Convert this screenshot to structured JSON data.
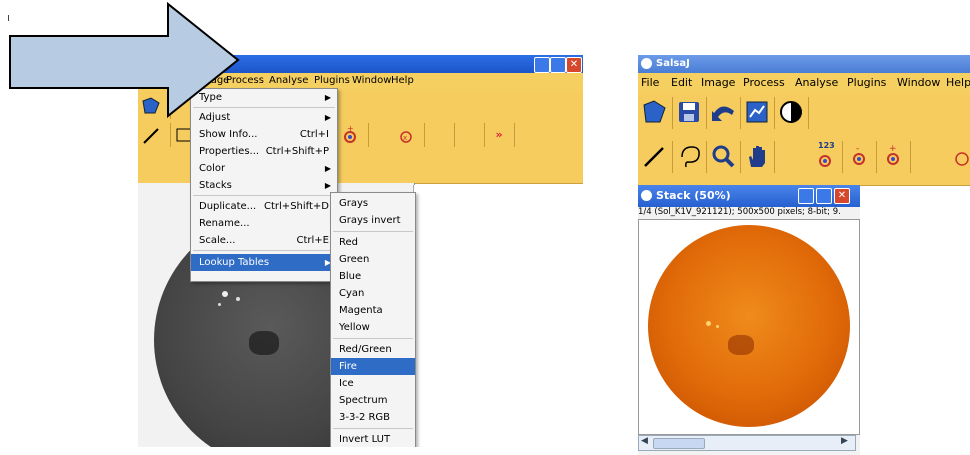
{
  "left": {
    "menubar": [
      "Image",
      "Process",
      "Analyse",
      "Plugins",
      "Window",
      "Help"
    ],
    "image_menu": {
      "items": [
        {
          "label": "Type",
          "shortcut": "",
          "submenu": true
        },
        {
          "label": "Adjust",
          "shortcut": "",
          "submenu": true
        },
        {
          "label": "Show Info...",
          "shortcut": "Ctrl+I",
          "submenu": false
        },
        {
          "label": "Properties...",
          "shortcut": "Ctrl+Shift+P",
          "submenu": false
        },
        {
          "label": "Color",
          "shortcut": "",
          "submenu": true
        },
        {
          "label": "Stacks",
          "shortcut": "",
          "submenu": true
        },
        {
          "label": "Duplicate...",
          "shortcut": "Ctrl+Shift+D",
          "submenu": false
        },
        {
          "label": "Rename...",
          "shortcut": "",
          "submenu": false
        },
        {
          "label": "Scale...",
          "shortcut": "Ctrl+E",
          "submenu": false
        },
        {
          "label": "Lookup Tables",
          "shortcut": "",
          "submenu": true,
          "selected": true
        }
      ]
    },
    "lut_menu": {
      "items": [
        "Grays",
        "Grays invert",
        "Red",
        "Green",
        "Blue",
        "Cyan",
        "Magenta",
        "Yellow",
        "Red/Green",
        "Fire",
        "Ice",
        "Spectrum",
        "3-3-2 RGB",
        "Invert LUT"
      ],
      "selected": "Fire"
    },
    "toolbar_more": "»"
  },
  "right": {
    "app_title": "SalsaJ",
    "menubar": [
      "File",
      "Edit",
      "Image",
      "Process",
      "Analyse",
      "Plugins",
      "Window",
      "Help"
    ],
    "toolbar_counter_label": "123",
    "stack_window": {
      "title": "Stack (50%)",
      "info": "1/4 (Sol_K1V_921121); 500x500 pixels; 8-bit; 9."
    }
  },
  "colors": {
    "toolbar": "#f5cc5d",
    "menu_highlight": "#2f6cc5",
    "arrow_fill": "#b7cbe3",
    "title_blue": "#2c6ee6"
  }
}
